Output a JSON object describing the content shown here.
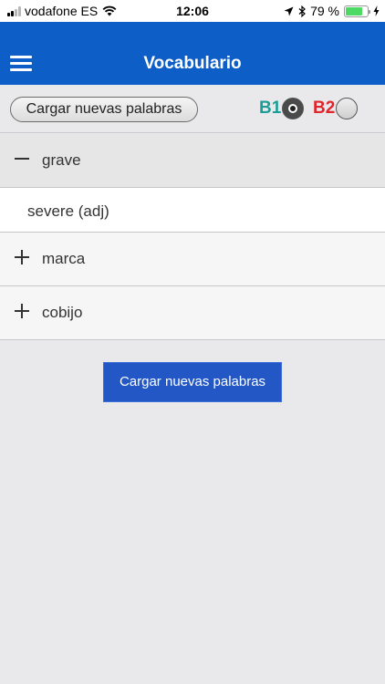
{
  "status_bar": {
    "carrier": "vodafone ES",
    "time": "12:06",
    "battery_percent": "79 %",
    "battery_level": 0.79,
    "icons": [
      "signal-icon",
      "wifi-icon",
      "location-arrow-icon",
      "bluetooth-icon",
      "battery-icon",
      "charging-bolt-icon"
    ]
  },
  "header": {
    "title": "Vocabulario",
    "menu_icon": "hamburger-menu-icon",
    "background_color": "#0d5ec6"
  },
  "toolbar": {
    "load_button_label": "Cargar nuevas palabras",
    "levels": [
      {
        "label": "B1",
        "color": "#1a9e97",
        "selected": true
      },
      {
        "label": "B2",
        "color": "#e0262b",
        "selected": false
      }
    ]
  },
  "words": [
    {
      "word": "grave",
      "expanded": true,
      "toggle_icon": "minus-icon",
      "translation": "severe (adj)"
    },
    {
      "word": "marca",
      "expanded": false,
      "toggle_icon": "plus-icon"
    },
    {
      "word": "cobijo",
      "expanded": false,
      "toggle_icon": "plus-icon"
    }
  ],
  "main": {
    "load_button_label": "Cargar nuevas palabras",
    "button_color": "#2357c5"
  }
}
